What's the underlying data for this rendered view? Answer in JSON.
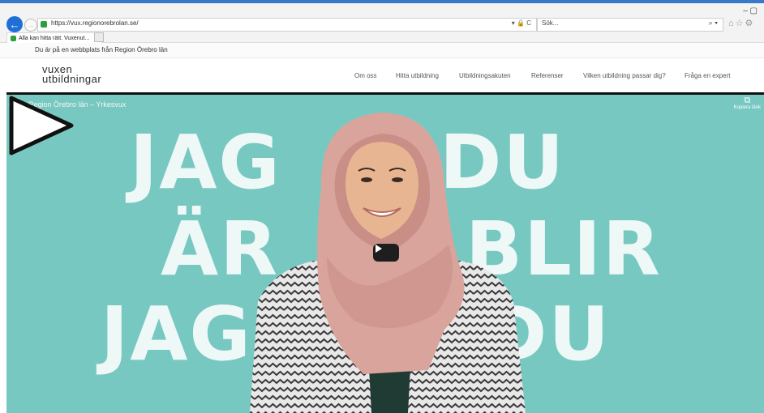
{
  "browser": {
    "url": "https://vux.regionorebrolan.se/",
    "search_placeholder": "Sök...",
    "tab_title": "Alla kan hitta rätt. Vuxenut...",
    "tab_close": "×",
    "back_glyph": "←",
    "forward_glyph": "→",
    "addr_icons": "▾ 🔒 C",
    "search_glyph": "⌕ ▾",
    "tool_glyphs": "⌂☆⚙",
    "window_controls": "–  ▢"
  },
  "notice": {
    "text": "Du är på en webbplats från Region Örebro län"
  },
  "site": {
    "logo_line1": "vuxen",
    "logo_line2": "utbildningar",
    "nav": [
      {
        "label": "Om oss"
      },
      {
        "label": "Hitta utbildning"
      },
      {
        "label": "Utbildningsakuten"
      },
      {
        "label": "Referenser"
      },
      {
        "label": "Vilken utbildning passar dig?"
      },
      {
        "label": "Fråga en expert"
      }
    ]
  },
  "video": {
    "title": "Region Örebro län – Yrkesvux",
    "copy_link_label": "Kopiera länk",
    "words": {
      "w1": "JAG",
      "w2": "DU",
      "w3": "ÄR",
      "w4": "BLIR",
      "w5": "JAG",
      "w6": "DU"
    },
    "colors": {
      "background": "#78c8c2",
      "accent_blue": "#1f6fd6"
    }
  }
}
